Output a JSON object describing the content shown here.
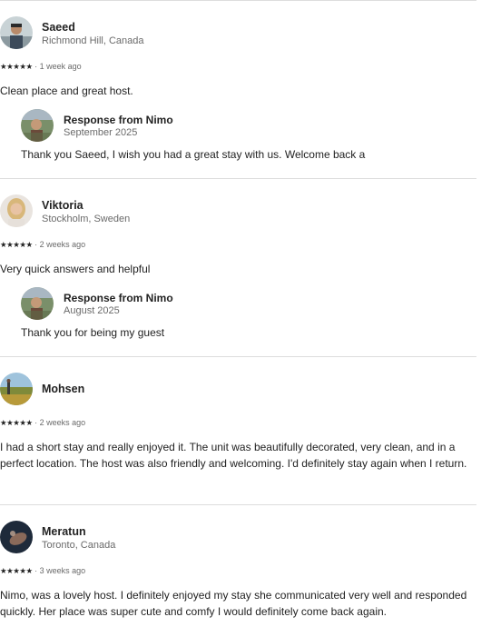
{
  "reviews": [
    {
      "name": "Saeed",
      "location": "Richmond Hill, Canada",
      "stars": "★★★★★",
      "separator": "·",
      "time": "1 week ago",
      "text": "Clean place and great host.",
      "response": {
        "title": "Response from Nimo",
        "date": "September 2025",
        "text": "Thank you Saeed, I wish you had a great stay with us. Welcome back a"
      }
    },
    {
      "name": "Viktoria",
      "location": "Stockholm, Sweden",
      "stars": "★★★★★",
      "separator": "·",
      "time": "2 weeks ago",
      "text": "Very quick answers and helpful",
      "response": {
        "title": "Response from Nimo",
        "date": "August 2025",
        "text": "Thank you for being my guest"
      }
    },
    {
      "name": "Mohsen",
      "stars": "★★★★★",
      "separator": "·",
      "time": "2 weeks ago",
      "text": "I had a short stay and really enjoyed it. The unit was beautifully decorated, very clean, and in a perfect location. The host was also friendly and welcoming. I'd definitely stay again when I return."
    },
    {
      "name": "Meratun",
      "location": "Toronto, Canada",
      "stars": "★★★★★",
      "separator": "·",
      "time": "3 weeks ago",
      "text": "Nimo, was a lovely host. I definitely enjoyed my stay she communicated very well and responded quickly. Her place was super cute and comfy I would definitely come back again."
    }
  ]
}
